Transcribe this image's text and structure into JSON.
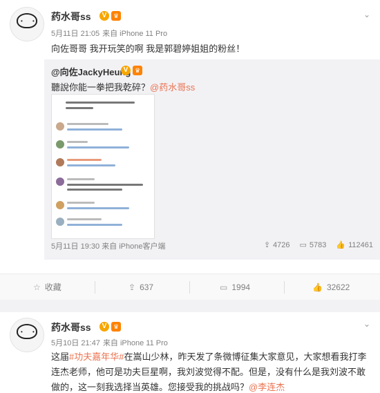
{
  "post1": {
    "username": "药水哥ss",
    "timestamp": "5月11日 21:05",
    "via": "来自 iPhone 11 Pro",
    "text": "向佐哥哥 我开玩笑的啊 我是郭碧婷姐姐的粉丝！",
    "repost": {
      "author": "@向佐JackyHeung",
      "text": "聽說你能一拳把我乾碎？",
      "mention": "@药水哥ss",
      "timestamp": "5月11日 19:30",
      "via": "来自 iPhone客户端",
      "reposts": "4726",
      "comments": "5783",
      "likes": "112461"
    },
    "actions": {
      "collect": "收藏",
      "repost": "637",
      "comment": "1994",
      "like": "32622"
    }
  },
  "post2": {
    "username": "药水哥ss",
    "timestamp": "5月10日 21:47",
    "via": "来自 iPhone 11 Pro",
    "text_prefix": "这届",
    "hashtag": "#功夫嘉年华#",
    "text_mid": "在嵩山少林，昨天发了条微博征集大家意见，大家想看我打李连杰老师，他可是功夫巨星啊，我刘波觉得不配。但是，没有什么是我刘波不敢做的，这一刻我选择当英雄。您接受我的挑战吗？",
    "mention": "@李连杰"
  },
  "icons": {
    "dropdown": "chevron-down-icon",
    "collect": "star-icon",
    "repost": "share-icon",
    "comment": "comment-icon",
    "like": "thumbs-up-icon"
  },
  "colors": {
    "accent": "#eb7350",
    "badge": "#f7a600"
  }
}
